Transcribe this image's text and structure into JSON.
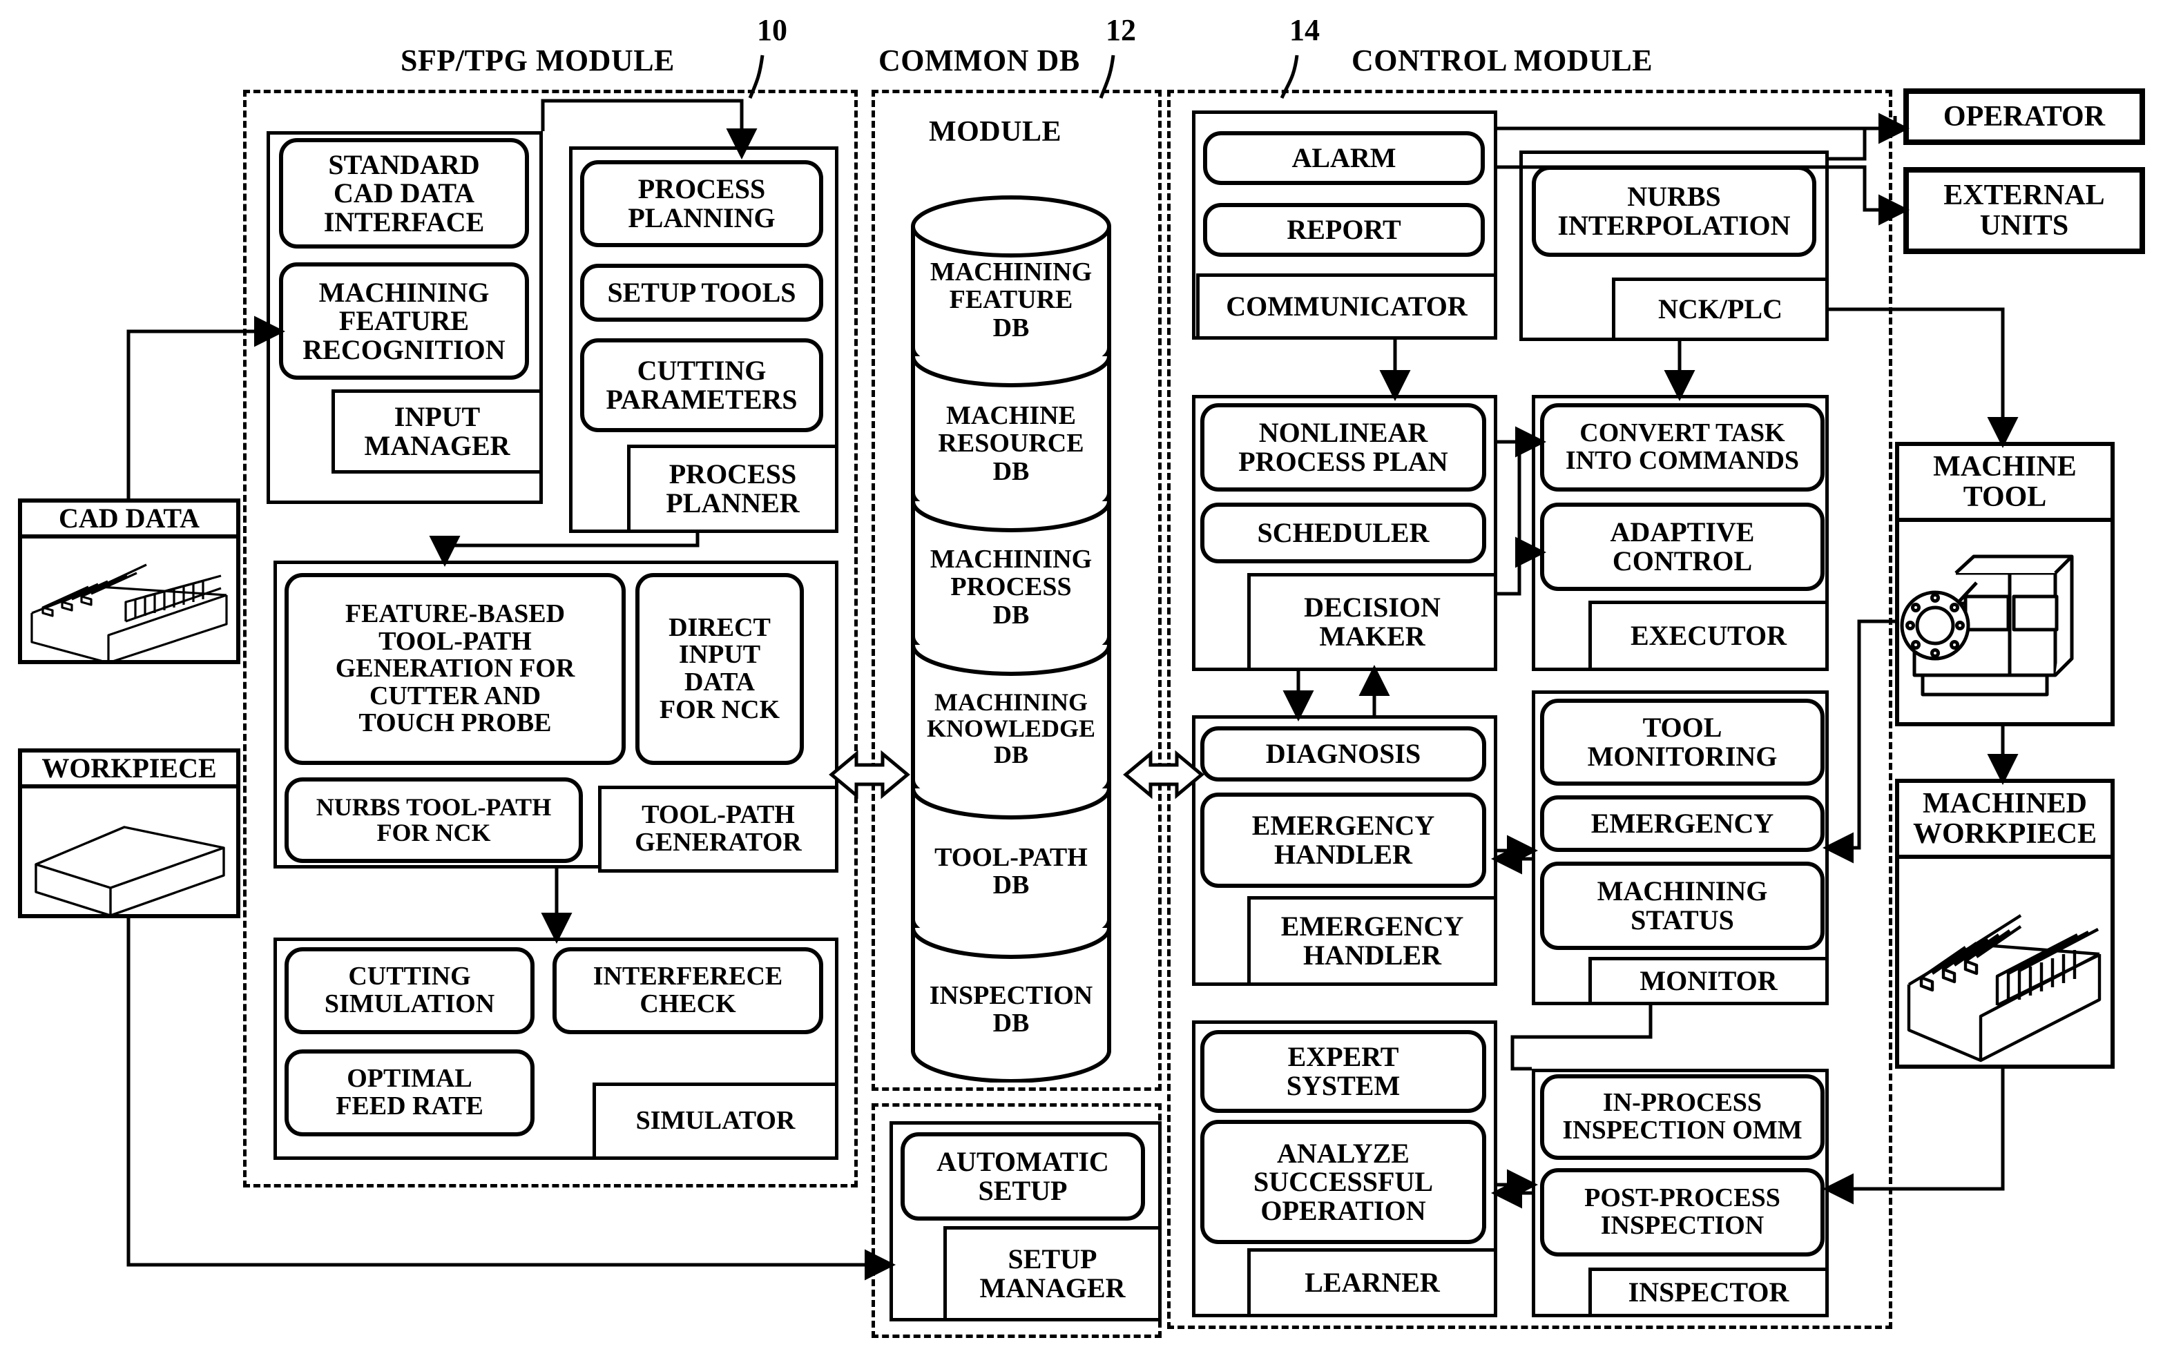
{
  "titles": {
    "sfp": "SFP/TPG MODULE",
    "common_db": "COMMON DB",
    "common_db_sub": "MODULE",
    "control": "CONTROL MODULE",
    "ref_10": "10",
    "ref_12": "12",
    "ref_14": "14"
  },
  "left_inputs": {
    "cad_data": "CAD DATA",
    "workpiece": "WORKPIECE"
  },
  "sfp": {
    "input_group": {
      "standard_cad": "STANDARD\nCAD DATA\nINTERFACE",
      "feature_recognition": "MACHINING\nFEATURE\nRECOGNITION",
      "input_manager": "INPUT\nMANAGER"
    },
    "process_group": {
      "process_planning": "PROCESS\nPLANNING",
      "setup_tools": "SETUP TOOLS",
      "cutting_parameters": "CUTTING\nPARAMETERS",
      "process_planner": "PROCESS\nPLANNER"
    },
    "toolpath_group": {
      "feature_based": "FEATURE-BASED\nTOOL-PATH\nGENERATION FOR\nCUTTER AND\nTOUCH PROBE",
      "direct_input": "DIRECT\nINPUT\nDATA\nFOR NCK",
      "nurbs_toolpath": "NURBS TOOL-PATH\nFOR NCK",
      "toolpath_generator": "TOOL-PATH\nGENERATOR"
    },
    "sim_group": {
      "cutting_simulation": "CUTTING\nSIMULATION",
      "interference_check": "INTERFERECE\nCHECK",
      "optimal_feed_rate": "OPTIMAL\nFEED RATE",
      "simulator": "SIMULATOR"
    }
  },
  "common_db": {
    "segments": [
      "MACHINING\nFEATURE\nDB",
      "MACHINE\nRESOURCE\nDB",
      "MACHINING\nPROCESS\nDB",
      "MACHINING\nKNOWLEDGE\nDB",
      "TOOL-PATH\nDB",
      "INSPECTION\nDB"
    ]
  },
  "setup_module": {
    "automatic_setup": "AUTOMATIC\nSETUP",
    "setup_manager": "SETUP\nMANAGER"
  },
  "control": {
    "comm_group": {
      "alarm": "ALARM",
      "report": "REPORT",
      "communicator": "COMMUNICATOR"
    },
    "nurbs_group": {
      "nurbs_interpolation": "NURBS\nINTERPOLATION",
      "nck_plc": "NCK/PLC"
    },
    "plan_group": {
      "nonlinear_process_plan": "NONLINEAR\nPROCESS PLAN",
      "scheduler": "SCHEDULER",
      "decision_maker": "DECISION\nMAKER"
    },
    "exec_group": {
      "convert_task": "CONVERT TASK\nINTO COMMANDS",
      "adaptive_control": "ADAPTIVE\nCONTROL",
      "executor": "EXECUTOR"
    },
    "diag_group": {
      "diagnosis": "DIAGNOSIS",
      "emergency_handler": "EMERGENCY\nHANDLER",
      "emergency_handler_label": "EMERGENCY\nHANDLER"
    },
    "monitor_group": {
      "tool_monitoring": "TOOL\nMONITORING",
      "emergency": "EMERGENCY",
      "machining_status": "MACHINING\nSTATUS",
      "monitor": "MONITOR"
    },
    "learn_group": {
      "expert_system": "EXPERT\nSYSTEM",
      "analyze_successful": "ANALYZE\nSUCCESSFUL\nOPERATION",
      "learner": "LEARNER"
    },
    "inspect_group": {
      "in_process_inspection": "IN-PROCESS\nINSPECTION OMM",
      "post_process_inspection": "POST-PROCESS\nINSPECTION",
      "inspector": "INSPECTOR"
    }
  },
  "external": {
    "operator": "OPERATOR",
    "external_units": "EXTERNAL\nUNITS",
    "machine_tool": "MACHINE\nTOOL",
    "machined_workpiece": "MACHINED\nWORKPIECE"
  }
}
